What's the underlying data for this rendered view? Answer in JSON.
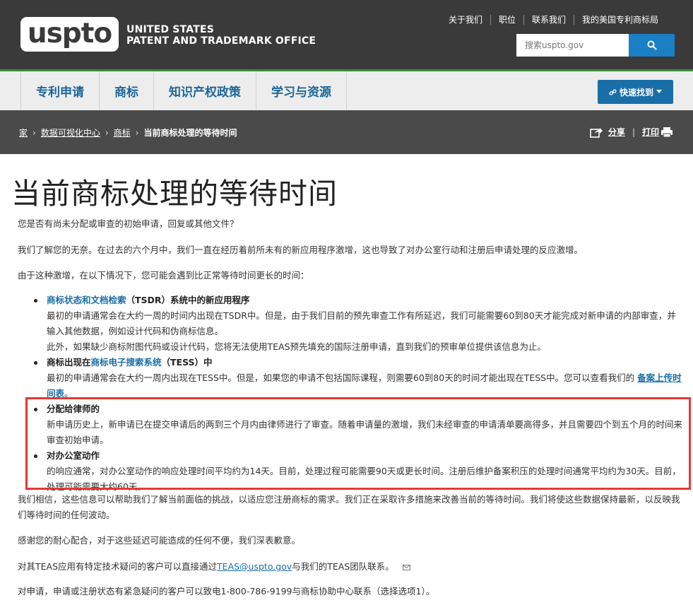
{
  "header": {
    "logo": "uspto",
    "agency_line1": "UNITED STATES",
    "agency_line2": "PATENT AND TRADEMARK OFFICE",
    "top_links": [
      "关于我们",
      "职位",
      "联系我们",
      "我的美国专利商标局"
    ],
    "search_placeholder": "搜索uspto.gov"
  },
  "nav": {
    "items": [
      "专利申请",
      "商标",
      "知识产权政策",
      "学习与资源"
    ],
    "quick_find": "快速找到"
  },
  "breadcrumb": {
    "items": [
      "家",
      "数据可视化中心",
      "商标"
    ],
    "current": "当前商标处理的等待时间",
    "share": "分享",
    "print": "打印"
  },
  "main": {
    "title": "当前商标处理的等待时间",
    "intro1": "您是否有尚未分配或审查的初始申请，回复或其他文件？",
    "intro2": "我们了解您的无奈。在过去的六个月中，我们一直在经历着前所未有的新应用程序激增，这也导致了对办公室行动和注册后申请处理的反应激增。",
    "intro3": "由于这种激增，在以下情况下，您可能会遇到比正常等待时间更长的时间：",
    "items": [
      {
        "title_link": "商标状态和文档检索",
        "title_rest": "（TSDR）系统中的新应用程序",
        "desc1": "最初的申请通常会在大约一周的时间内出现在TSDR中。但是，由于我们目前的预先审查工作有所延迟，我们可能需要60到80天才能完成对新申请的内部审查，并输入其他数据，例如设计代码和伪商标信息。",
        "desc2": "此外，如果缺少商标附图代码或设计代码，您将无法使用TEAS预先填充的国际注册申请，直到我们的预审单位提供该信息为止。"
      },
      {
        "title_pre": "商标出现在",
        "title_link": "商标电子搜索系统",
        "title_rest": "（TESS）中",
        "desc1": "最初的申请通常会在大约一周内出现在TESS中。但是，如果您的申请不包括国际课程，则需要60到80天的时间才能出现在TESS中。您可以查看我们的",
        "desc_link": "备案上传时间表",
        "desc_end": "。"
      },
      {
        "title": "分配给律师的",
        "desc1": "新申请历史上，新申请已在提交申请后的两到三个月内由律师进行了审查。随着申请量的激增，我们未经审查的申请清单要高得多，并且需要四个到五个月的时间来审查初始申请。"
      },
      {
        "title": "对办公室动作",
        "desc1": "的响应通常，对办公室动作的响应处理时间平均约为14天。目前，处理过程可能需要90天或更长时间。注册后维护备案积压的处理时间通常平均约为30天。目前，处理可能需要大约60天。"
      }
    ],
    "outro1": "我们相信，这些信息可以帮助我们了解当前面临的挑战，以适应您注册商标的需求。我们正在采取许多措施来改善当前的等待时间。我们将使这些数据保持最新，以反映我们等待时间的任何波动。",
    "outro2": "感谢您的耐心配合，对于这些延迟可能造成的任何不便，我们深表歉意。",
    "outro3_pre": "对其TEAS应用有特定技术疑问的客户可以直接通过",
    "outro3_link": "TEAS@uspto.gov",
    "outro3_post": "与我们的TEAS团队联系。",
    "outro4": "对申请，申请或注册状态有紧急疑问的客户可以致电1-800-786-9199与商标协助中心联系（选择选项1）。"
  },
  "colors": {
    "header_bg": "#3a3a3a",
    "nav_bg": "#ededed",
    "nav_accent": "#3f8a3f",
    "link": "#1a6ea8",
    "highlight_border": "#e53935"
  }
}
